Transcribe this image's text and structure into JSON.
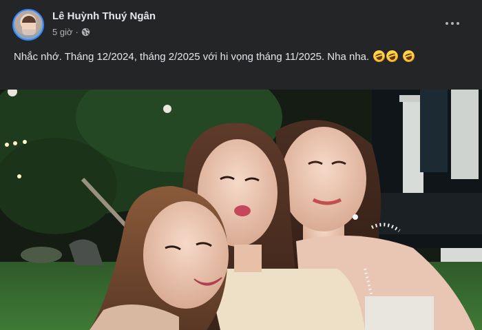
{
  "post": {
    "author": "Lê Huỳnh Thuý Ngân",
    "time": "5 giờ",
    "separator": "·",
    "text": "Nhắc nhớ. Tháng 12/2024,  tháng 2/2025 với hi vọng tháng 11/2025. Nha nha.",
    "emoji_name": "rolling-on-floor-laughing",
    "emoji_count": 3
  },
  "icons": {
    "privacy": "globe-icon",
    "more": "more-options-icon"
  },
  "colors": {
    "background": "#242526",
    "text_primary": "#e4e6eb",
    "text_secondary": "#b0b3b8",
    "avatar_ring": "#2d88ff"
  },
  "photo": {
    "subject": "selfie of three women at an outdoor evening venue"
  }
}
